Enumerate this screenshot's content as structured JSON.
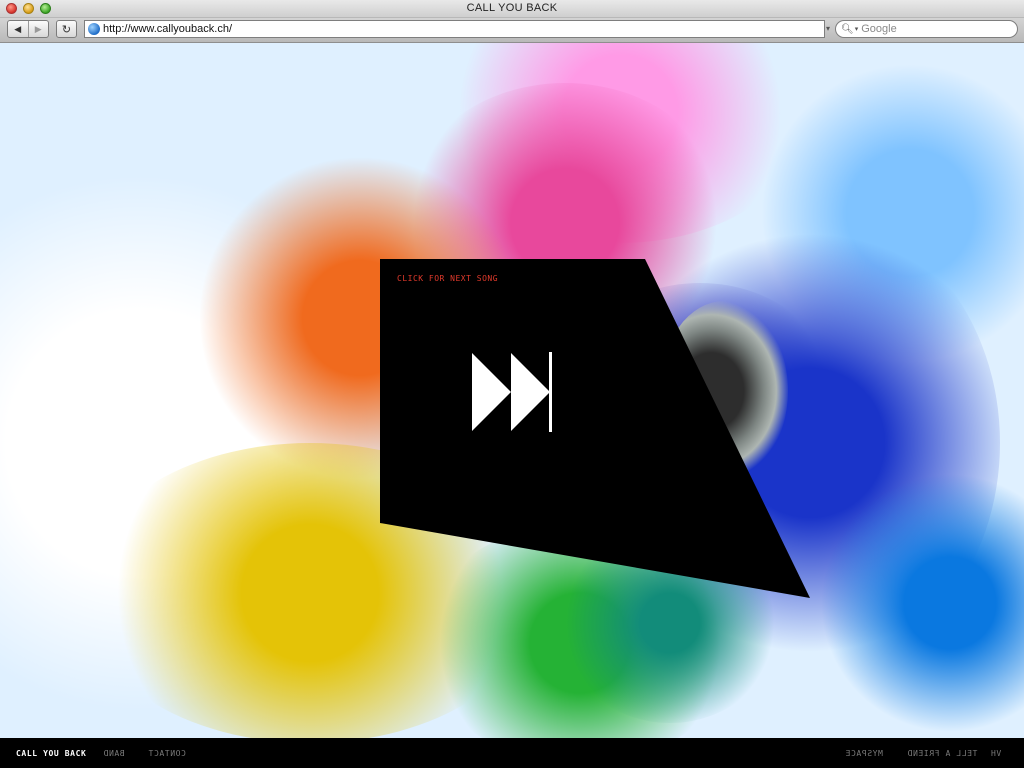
{
  "browser": {
    "window_title": "CALL YOU BACK",
    "url": "http://www.callyouback.ch/",
    "search_placeholder": "Google",
    "back_glyph": "◀",
    "forward_glyph": "▶",
    "reload_glyph": "↻"
  },
  "panel": {
    "label": "CLICK FOR NEXT SONG",
    "icon": "next-track-icon",
    "label_color": "#e23a2c",
    "background": "#000000"
  },
  "bottom_nav": {
    "items": [
      {
        "label": "CALL YOU BACK",
        "active": true,
        "mirrored": false
      },
      {
        "label": "BAND",
        "active": false,
        "mirrored": true
      },
      {
        "label": "CONTACT",
        "active": false,
        "mirrored": true
      },
      {
        "label": "MYSPACE",
        "active": false,
        "mirrored": true
      },
      {
        "label": "TELL A FRIEND",
        "active": false,
        "mirrored": true
      },
      {
        "label": "HV",
        "active": false,
        "mirrored": false
      }
    ]
  }
}
